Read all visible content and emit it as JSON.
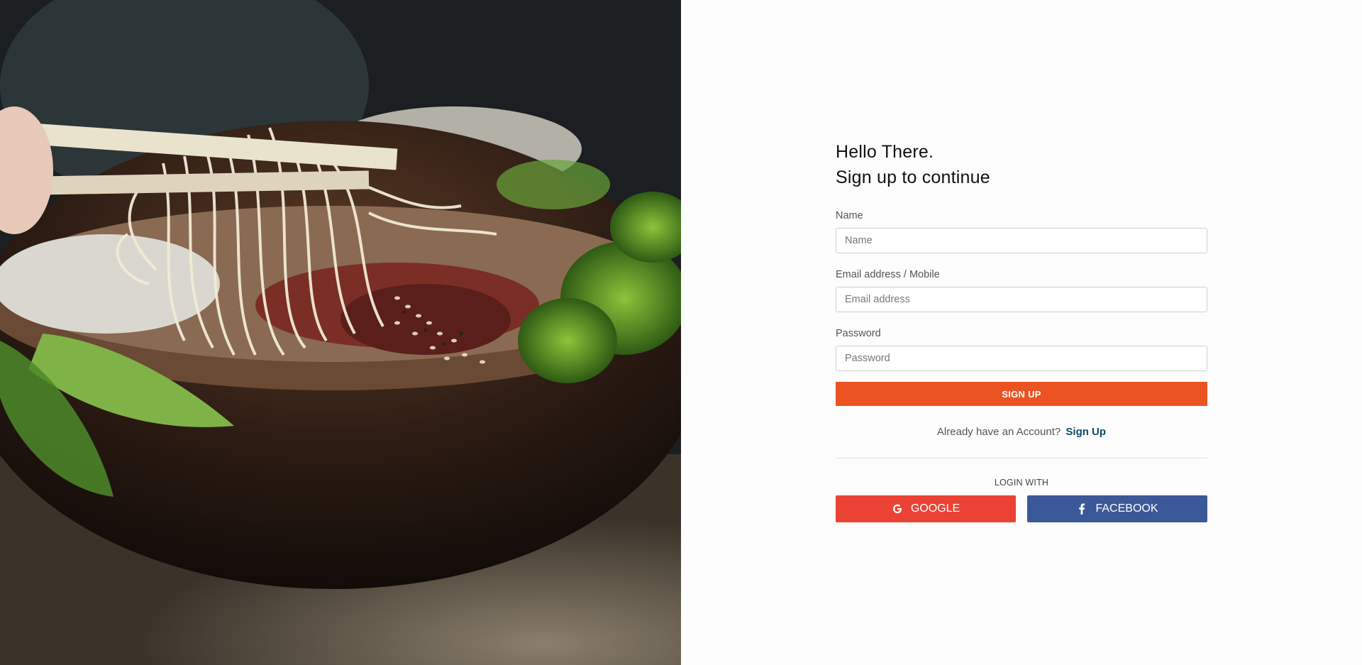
{
  "greeting": {
    "line1": "Hello There.",
    "line2": "Sign up to continue"
  },
  "form": {
    "name": {
      "label": "Name",
      "placeholder": "Name"
    },
    "email": {
      "label": "Email address / Mobile",
      "placeholder": "Email address"
    },
    "password": {
      "label": "Password",
      "placeholder": "Password"
    },
    "submit_label": "SIGN UP"
  },
  "account": {
    "prompt": "Already have an Account?",
    "link_label": "Sign Up"
  },
  "social": {
    "heading": "LOGIN WITH",
    "google_label": "GOOGLE",
    "facebook_label": "FACEBOOK",
    "google_icon": "google-icon",
    "facebook_icon": "facebook-icon"
  },
  "colors": {
    "primary": "#ec5323",
    "link": "#0d4b6b",
    "google": "#ea4335",
    "facebook": "#3b5998"
  },
  "hero": {
    "image": "food-photo-noodle-bowl"
  }
}
